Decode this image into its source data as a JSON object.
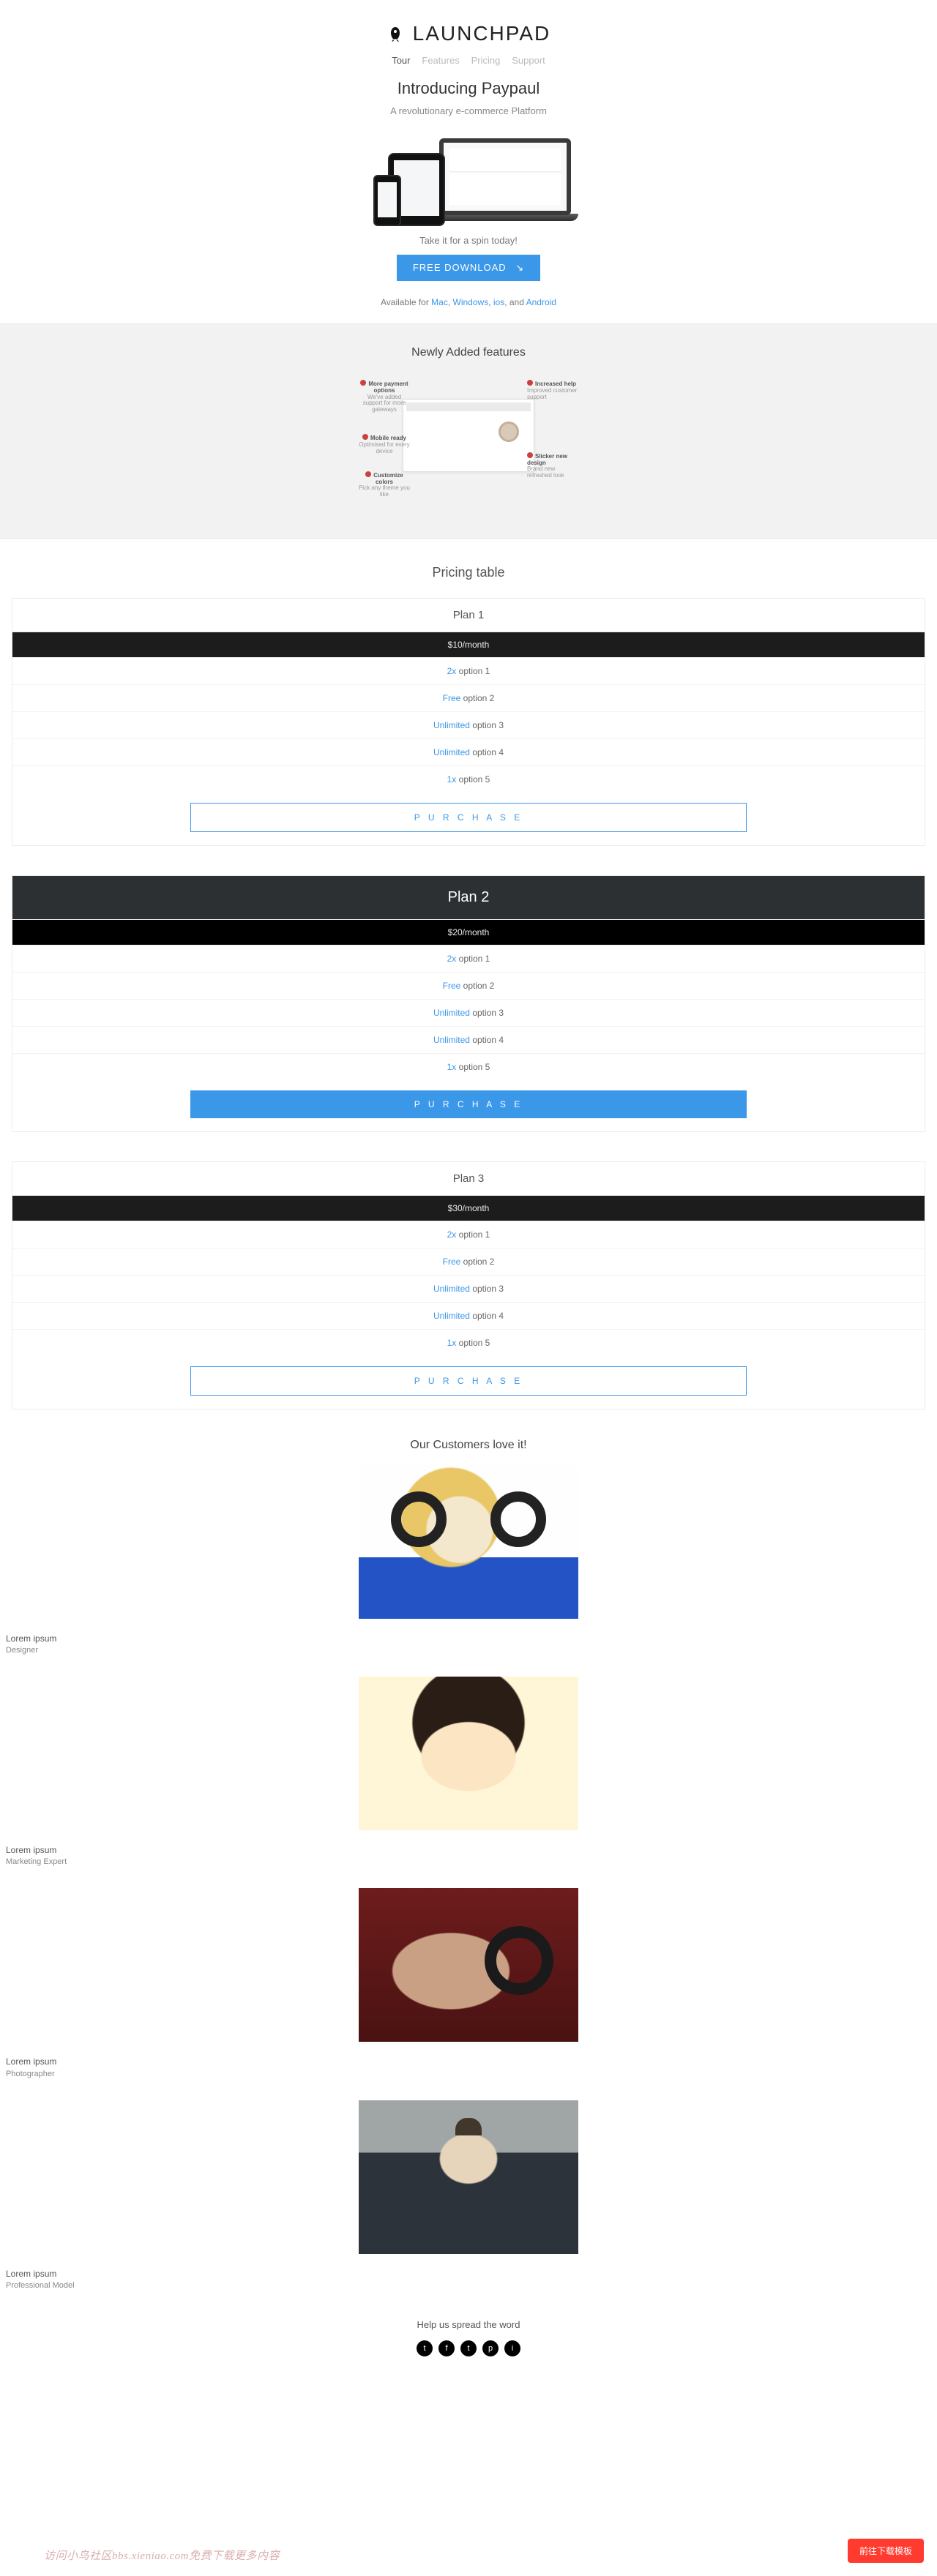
{
  "brand": "LAUNCHPAD",
  "nav": {
    "items": [
      "Tour",
      "Features",
      "Pricing",
      "Support"
    ],
    "activeIndex": 0
  },
  "hero": {
    "title": "Introducing Paypaul",
    "subtitle": "A revolutionary e-commerce Platform",
    "spin": "Take it for a spin today!",
    "download_label": "FREE DOWNLOAD",
    "available_prefix": "Available for ",
    "platforms": [
      "Mac",
      "Windows",
      "ios"
    ],
    "platforms_sep": ", ",
    "platforms_and": ", and ",
    "platforms_last": "Android"
  },
  "features": {
    "title": "Newly Added features",
    "callouts": [
      {
        "head": "More payment options",
        "body": "We've added support for more gateways"
      },
      {
        "head": "Increased help",
        "body": "Improved customer support"
      },
      {
        "head": "Mobile ready",
        "body": "Optimised for every device"
      },
      {
        "head": "Customize colors",
        "body": "Pick any theme you like"
      },
      {
        "head": "Slicker new design",
        "body": "Brand new refreshed look"
      }
    ]
  },
  "pricing": {
    "title": "Pricing table",
    "purchase_label": "P U R C H A S E",
    "plans": [
      {
        "name": "Plan 1",
        "price": "$10/month",
        "featured": false,
        "rows": [
          {
            "hl": "2x",
            "txt": "option 1"
          },
          {
            "hl": "Free",
            "txt": "option 2"
          },
          {
            "hl": "Unlimited",
            "txt": "option 3"
          },
          {
            "hl": "Unlimited",
            "txt": "option 4"
          },
          {
            "hl": "1x",
            "txt": "option 5"
          }
        ]
      },
      {
        "name": "Plan 2",
        "price": "$20/month",
        "featured": true,
        "rows": [
          {
            "hl": "2x",
            "txt": "option 1"
          },
          {
            "hl": "Free",
            "txt": "option 2"
          },
          {
            "hl": "Unlimited",
            "txt": "option 3"
          },
          {
            "hl": "Unlimited",
            "txt": "option 4"
          },
          {
            "hl": "1x",
            "txt": "option 5"
          }
        ]
      },
      {
        "name": "Plan 3",
        "price": "$30/month",
        "featured": false,
        "rows": [
          {
            "hl": "2x",
            "txt": "option 1"
          },
          {
            "hl": "Free",
            "txt": "option 2"
          },
          {
            "hl": "Unlimited",
            "txt": "option 3"
          },
          {
            "hl": "Unlimited",
            "txt": "option 4"
          },
          {
            "hl": "1x",
            "txt": "option 5"
          }
        ]
      }
    ]
  },
  "customers": {
    "title": "Our Customers love it!",
    "items": [
      {
        "name": "Lorem ipsum",
        "role": "Designer"
      },
      {
        "name": "Lorem ipsum",
        "role": "Marketing Expert"
      },
      {
        "name": "Lorem ipsum",
        "role": "Photographer"
      },
      {
        "name": "Lorem ipsum",
        "role": "Professional Model"
      }
    ]
  },
  "spread_title": "Help us spread the word",
  "social_icons": [
    "twitter-icon",
    "facebook-icon",
    "twitter-icon",
    "pinterest-icon",
    "instagram-icon"
  ],
  "float_dl": "前往下载模板",
  "watermark": "访问小鸟社区bbs.xieniao.com免费下载更多内容"
}
